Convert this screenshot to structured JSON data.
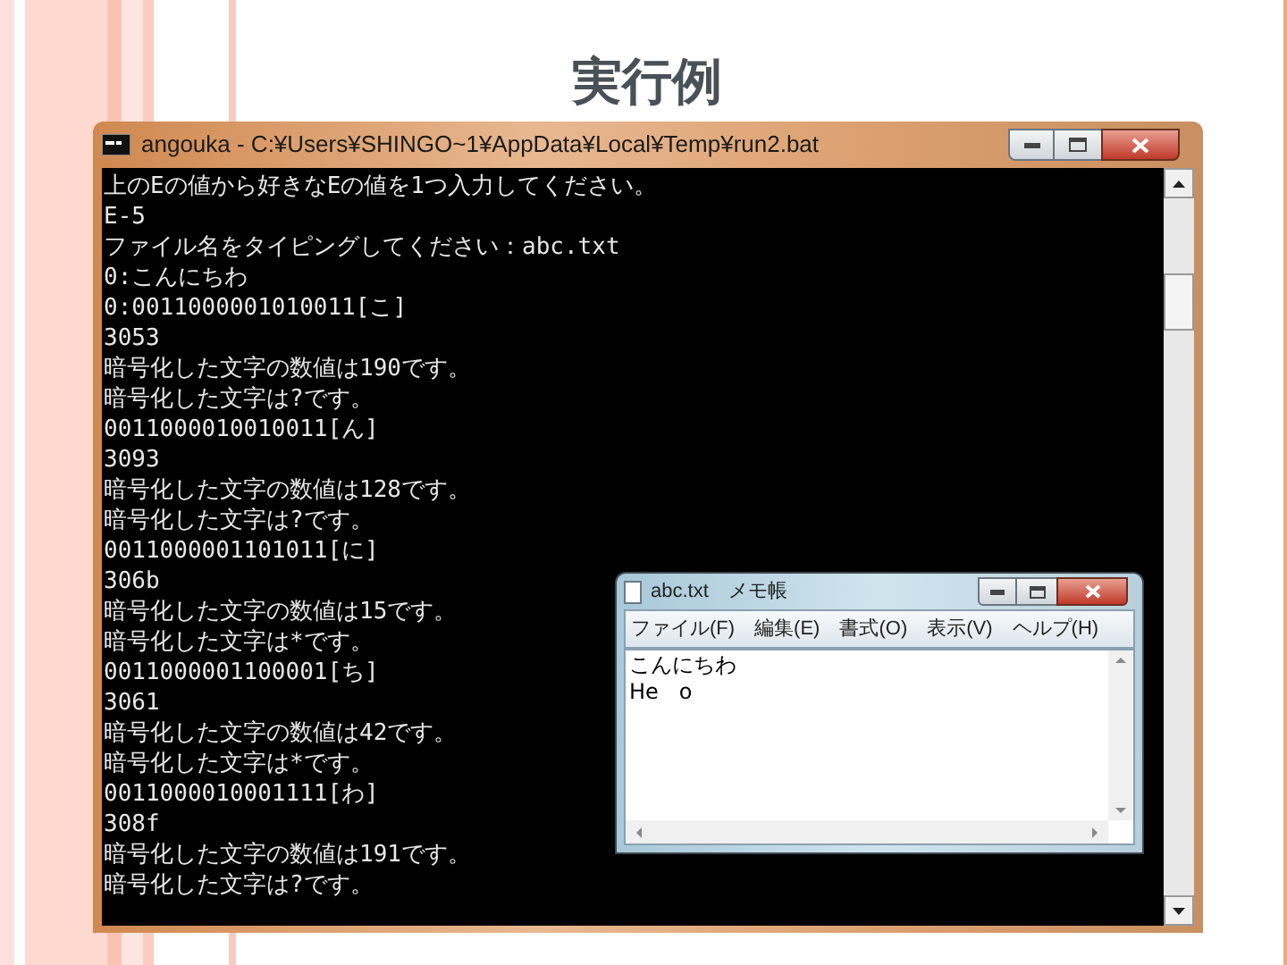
{
  "slide": {
    "title": "実行例"
  },
  "console": {
    "title": "angouka - C:¥Users¥SHINGO~1¥AppData¥Local¥Temp¥run2.bat",
    "lines": [
      "上のEの値から好きなEの値を1つ入力してください。",
      "E-5",
      "ファイル名をタイピングしてください：abc.txt",
      "0:こんにちわ",
      "0:0011000001010011[こ]",
      "3053",
      "暗号化した文字の数値は190です。",
      "暗号化した文字は?です。",
      "0011000010010011[ん]",
      "3093",
      "暗号化した文字の数値は128です。",
      "暗号化した文字は?です。",
      "0011000001101011[に]",
      "306b",
      "暗号化した文字の数値は15です。",
      "暗号化した文字は*です。",
      "0011000001100001[ち]",
      "3061",
      "暗号化した文字の数値は42です。",
      "暗号化した文字は*です。",
      "0011000010001111[わ]",
      "308f",
      "暗号化した文字の数値は191です。",
      "暗号化した文字は?です。"
    ]
  },
  "notepad": {
    "title": "abc.txt　メモ帳",
    "menu": [
      "ファイル(F)",
      "編集(E)",
      "書式(O)",
      "表示(V)",
      "ヘルプ(H)"
    ],
    "lines": [
      "こんにちわ",
      "He   o"
    ]
  }
}
